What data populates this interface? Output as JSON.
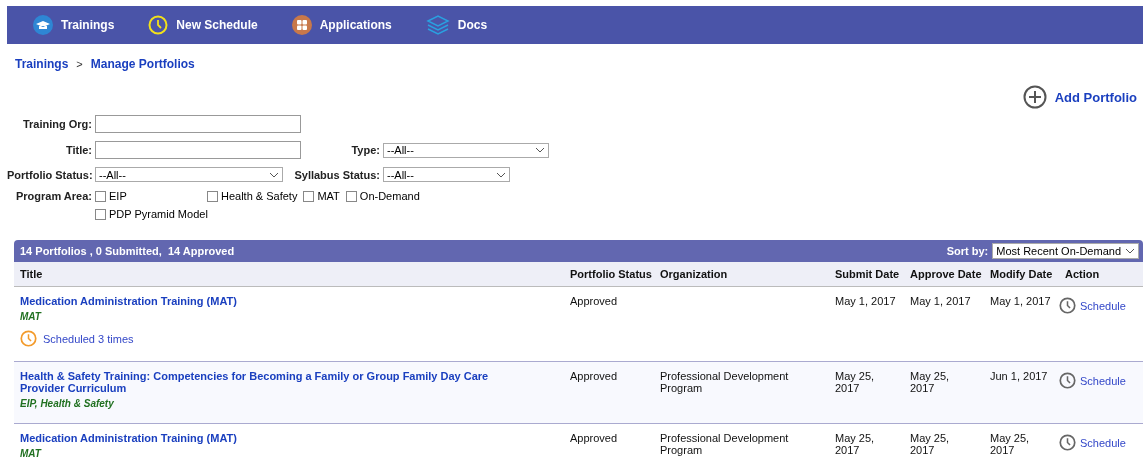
{
  "nav": [
    {
      "kind": "cap",
      "label": "Trainings"
    },
    {
      "kind": "clock",
      "label": "New Schedule"
    },
    {
      "kind": "grid",
      "label": "Applications"
    },
    {
      "kind": "layers",
      "label": "Docs"
    }
  ],
  "breadcrumb": {
    "items": [
      "Trainings",
      "Manage Portfolios"
    ],
    "separator": ">"
  },
  "add_button": "Add Portfolio",
  "filters": {
    "training_org": {
      "label": "Training Org:"
    },
    "title": {
      "label": "Title:"
    },
    "type": {
      "label": "Type:",
      "value": "--All--"
    },
    "portfolio_status": {
      "label": "Portfolio Status:",
      "value": "--All--"
    },
    "syllabus_status": {
      "label": "Syllabus Status:",
      "value": "--All--"
    },
    "program_area": {
      "label": "Program Area:",
      "options": [
        {
          "label": "EIP",
          "checked": false
        },
        {
          "label": "Health & Safety",
          "checked": false
        },
        {
          "label": "MAT",
          "checked": false
        },
        {
          "label": "On-Demand",
          "checked": false
        },
        {
          "label": "PDP Pyramid Model",
          "checked": false
        }
      ]
    }
  },
  "table": {
    "summary": "14 Portfolios , 0 Submitted,  14 Approved",
    "sort_label": "Sort by:",
    "sort_value": "Most Recent On-Demand",
    "columns": [
      "Title",
      "Portfolio Status",
      "Organization",
      "Submit Date",
      "Approve Date",
      "Modify Date",
      "Action"
    ],
    "rows": [
      {
        "title": "Medication Administration Training (MAT)",
        "tags": "MAT",
        "scheduled": "Scheduled 3 times",
        "status": "Approved",
        "organization": "",
        "submit_date": "May 1, 2017",
        "approve_date": "May 1, 2017",
        "modify_date": "May 1, 2017",
        "action": "Schedule"
      },
      {
        "title": "Health & Safety Training: Competencies for Becoming a Family or Group Family Day Care Provider Curriculum",
        "tags": "EIP, Health & Safety",
        "status": "Approved",
        "organization": "Professional Development Program",
        "submit_date": "May 25, 2017",
        "approve_date": "May 25, 2017",
        "modify_date": "Jun 1, 2017",
        "action": "Schedule"
      },
      {
        "title": "Medication Administration Training (MAT)",
        "tags": "MAT",
        "status": "Approved",
        "organization": "Professional Development Program",
        "submit_date": "May 25, 2017",
        "approve_date": "May 25, 2017",
        "modify_date": "May 25, 2017",
        "action": "Schedule"
      }
    ]
  }
}
